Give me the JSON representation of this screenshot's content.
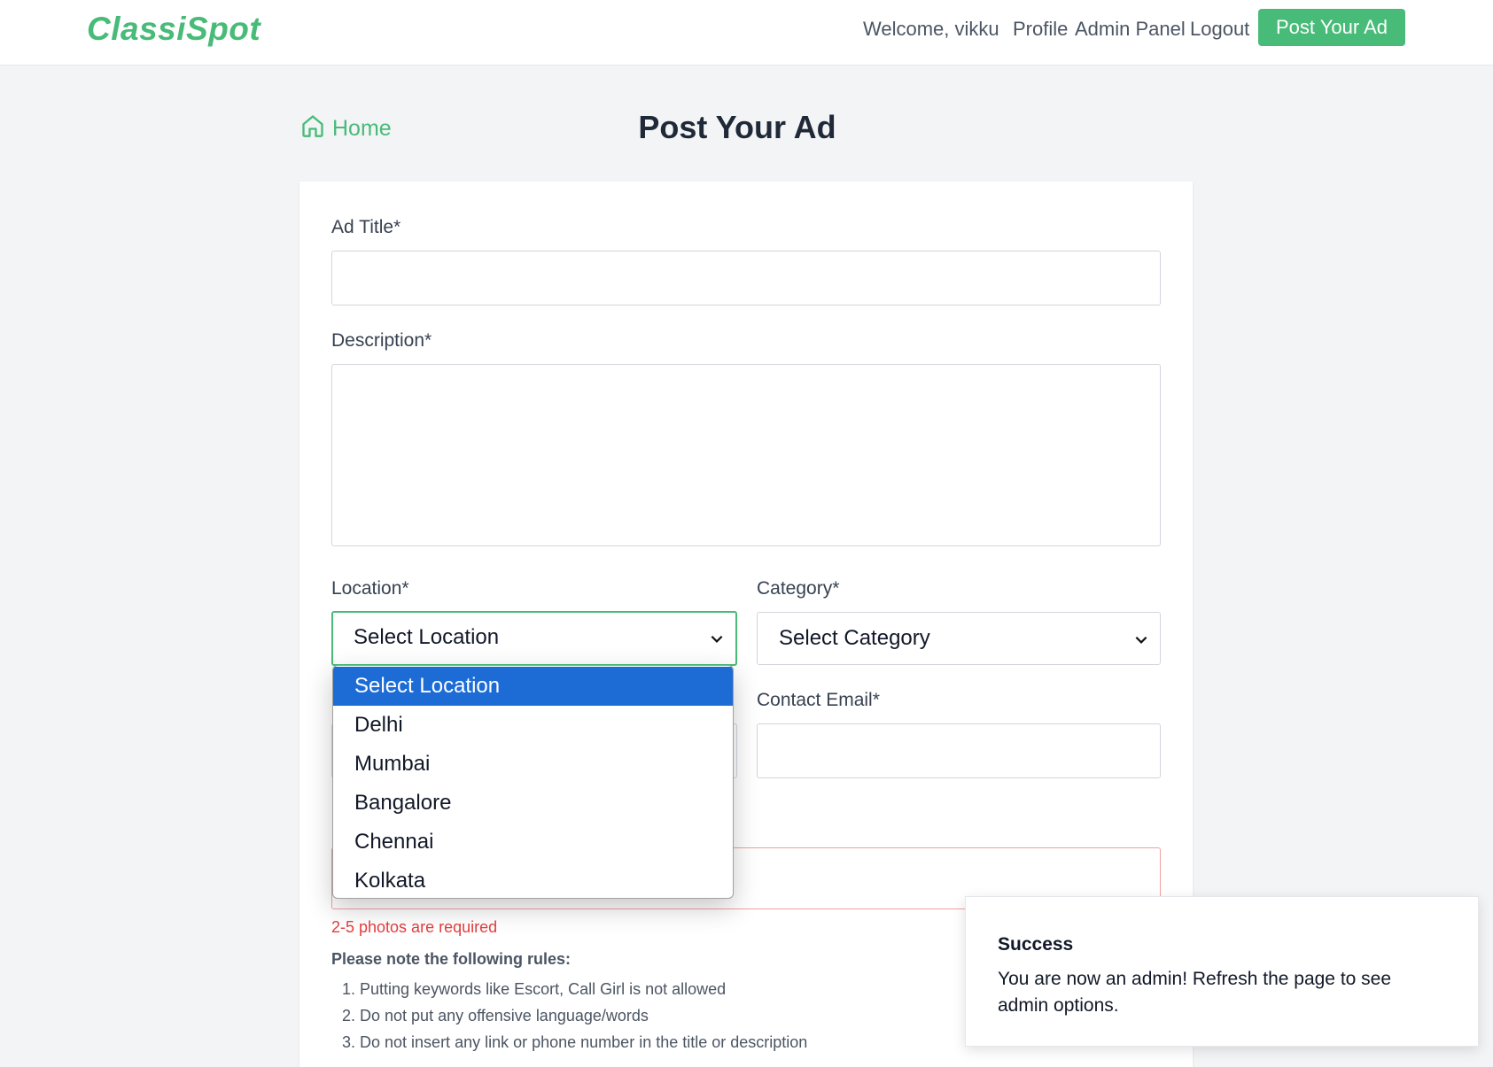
{
  "nav": {
    "brand": "ClassiSpot",
    "welcome": "Welcome, vikku",
    "profile": "Profile",
    "admin_panel": "Admin Panel",
    "logout": "Logout",
    "post_ad": "Post Your Ad"
  },
  "breadcrumb": {
    "home": "Home",
    "icon": "home-icon"
  },
  "page": {
    "title": "Post Your Ad"
  },
  "form": {
    "ad_title_label": "Ad Title*",
    "ad_title_value": "",
    "description_label": "Description*",
    "description_value": "",
    "location_label": "Location*",
    "location_selected": "Select Location",
    "category_label": "Category*",
    "category_selected": "Select Category",
    "contact_email_label": "Contact Email*",
    "contact_email_value": "",
    "photos_error": "2-5 photos are required",
    "rules_heading": "Please note the following rules:",
    "rules": [
      "1. Putting keywords like Escort, Call Girl is not allowed",
      "2. Do not put any offensive language/words",
      "3. Do not insert any link or phone number in the title or description"
    ]
  },
  "location_dropdown": {
    "options": [
      "Select Location",
      "Delhi",
      "Mumbai",
      "Bangalore",
      "Chennai",
      "Kolkata"
    ],
    "highlighted": "Select Location"
  },
  "toast": {
    "title": "Success",
    "message": "You are now an admin! Refresh the page to see admin options."
  },
  "colors": {
    "brand": "#48bb78",
    "dropdown_highlight": "#1d6cd6",
    "error": "#e53e3e"
  }
}
